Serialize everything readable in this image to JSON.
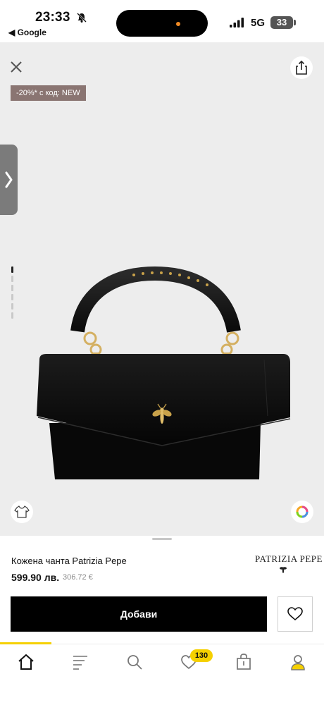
{
  "status_bar": {
    "time": "23:33",
    "back_label": "◀ Google",
    "network": "5G",
    "battery": "33"
  },
  "product": {
    "promo": "-20%* с код: NEW",
    "title": "Кожена чанта Patrizia Pepe",
    "price": "599.90 лв.",
    "old_price": "306.72 €",
    "brand": "PATRIZIA PEPE",
    "image_index": 1,
    "image_count": 7
  },
  "actions": {
    "add_label": "Добави"
  },
  "nav": {
    "wishlist_badge": "130",
    "items": [
      "home-icon",
      "catalog-icon",
      "search-icon",
      "heart-icon",
      "bag-icon",
      "account-icon"
    ]
  },
  "colors": {
    "accent": "#f5d000",
    "promo_bg": "#8a7572",
    "hero_bg": "#ededed"
  }
}
